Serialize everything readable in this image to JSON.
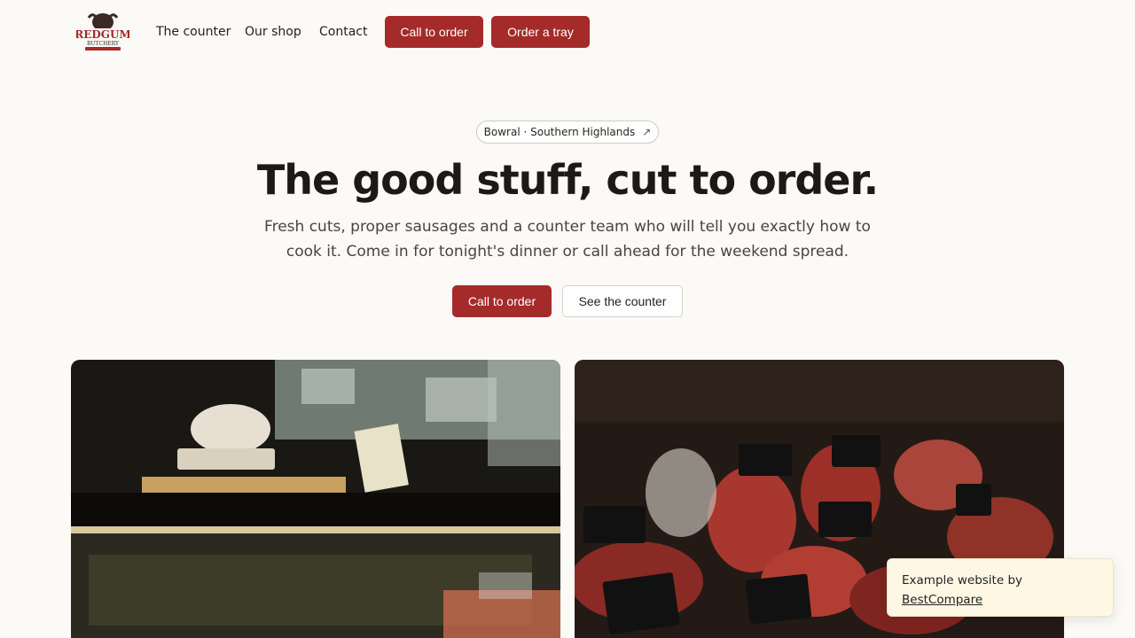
{
  "brand": {
    "name": "REDGUM",
    "subname": "BUTCHERY",
    "logo_icon": "bull-head-logo"
  },
  "nav": {
    "items": [
      {
        "label": "The counter"
      },
      {
        "label": "Our shop"
      },
      {
        "label": "Contact"
      }
    ],
    "call_label": "Call to order",
    "tray_label": "Order a tray"
  },
  "hero": {
    "location": "Bowral · Southern Highlands",
    "location_icon": "arrow-up-right-icon",
    "title": "The good stuff, cut to order.",
    "subtitle": "Fresh cuts, proper sausages and a counter team who will tell you exactly how to cook it. Come in for tonight's dinner or call ahead for the weekend spread.",
    "primary_label": "Call to order",
    "secondary_label": "See the counter"
  },
  "toast": {
    "text": "Example website by",
    "link": "BestCompare"
  },
  "colors": {
    "accent": "#a52a2a",
    "background": "#fcfaf6",
    "toast_bg": "#fdf7e4"
  }
}
